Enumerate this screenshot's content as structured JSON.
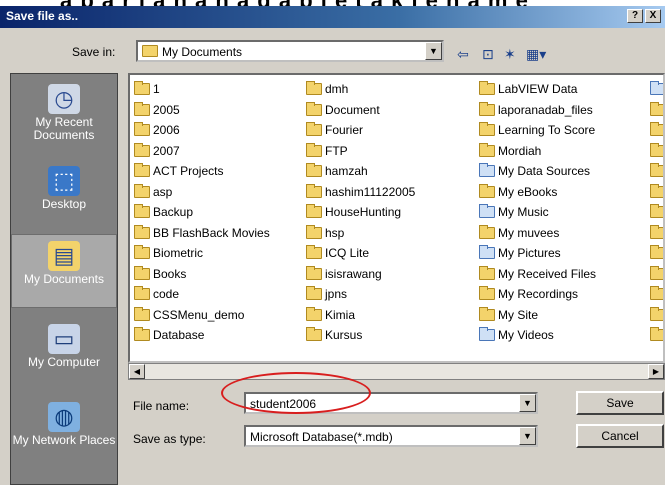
{
  "background_text": "a p a r l a n a n a d a b   l e t a k   l e   n a m e",
  "window": {
    "title": "Save file as..",
    "help_button": "?",
    "close_button": "X"
  },
  "save_in": {
    "label": "Save in:",
    "value": "My Documents"
  },
  "places": [
    {
      "label": "My Recent Documents",
      "icon": "recent-documents-icon"
    },
    {
      "label": "Desktop",
      "icon": "desktop-icon"
    },
    {
      "label": "My Documents",
      "icon": "my-documents-icon"
    },
    {
      "label": "My Computer",
      "icon": "my-computer-icon"
    },
    {
      "label": "My Network Places",
      "icon": "network-places-icon"
    }
  ],
  "files": {
    "col1": [
      "1",
      "2005",
      "2006",
      "2007",
      "ACT Projects",
      "asp",
      "Backup",
      "BB FlashBack Movies",
      "Biometric",
      "Books",
      "code",
      "CSSMenu_demo",
      "Database"
    ],
    "col2": [
      "dmh",
      "Document",
      "Fourier",
      "FTP",
      "hamzah",
      "hashim11122005",
      "HouseHunting",
      "hsp",
      "ICQ Lite",
      "isisrawang",
      "jpns",
      "Kimia",
      "Kursus"
    ],
    "col3": [
      "LabVIEW Data",
      "laporanadab_files",
      "Learning To Score",
      "Mordiah",
      "My Data Sources",
      "My eBooks",
      "My Music",
      "My muvees",
      "My Pictures",
      "My Received Files",
      "My Recordings",
      "My Site",
      "My Videos"
    ]
  },
  "file_name": {
    "label": "File name:",
    "value": "student2006"
  },
  "save_as_type": {
    "label": "Save as type:",
    "value": "Microsoft Database(*.mdb)"
  },
  "buttons": {
    "save": "Save",
    "cancel": "Cancel"
  },
  "colors": {
    "highlight": "#d81e1e",
    "titlebar": "#0a246a"
  }
}
